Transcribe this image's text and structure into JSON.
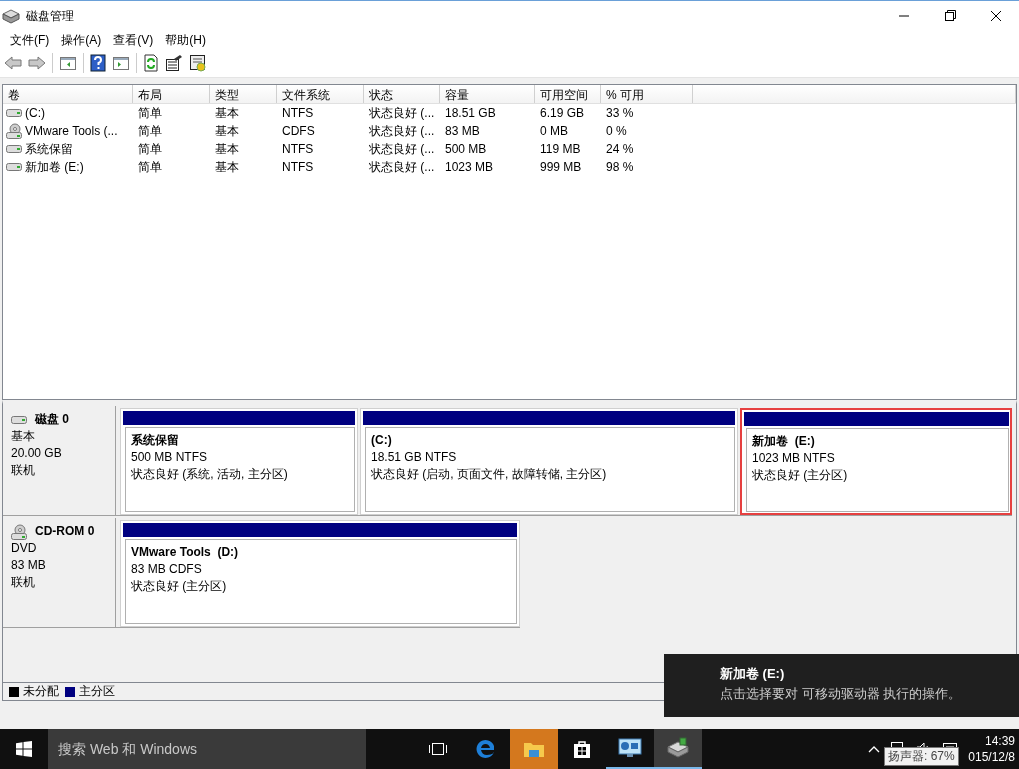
{
  "window": {
    "title": "磁盘管理"
  },
  "menu": [
    "文件(F)",
    "操作(A)",
    "查看(V)",
    "帮助(H)"
  ],
  "toolbar": [
    {
      "kind": "back",
      "disabled": true
    },
    {
      "kind": "forward",
      "disabled": true
    },
    {
      "kind": "sep"
    },
    {
      "kind": "pane",
      "disabled": false
    },
    {
      "kind": "sep"
    },
    {
      "kind": "help",
      "disabled": false
    },
    {
      "kind": "pane2",
      "disabled": false
    },
    {
      "kind": "sep"
    },
    {
      "kind": "refresh",
      "disabled": false
    },
    {
      "kind": "props",
      "disabled": false
    },
    {
      "kind": "settings",
      "disabled": false
    }
  ],
  "table": {
    "columns": [
      "卷",
      "布局",
      "类型",
      "文件系统",
      "状态",
      "容量",
      "可用空间",
      "% 可用"
    ],
    "rows": [
      {
        "kind": "disk",
        "cells": [
          "(C:)",
          "简单",
          "基本",
          "NTFS",
          "状态良好 (...",
          "18.51 GB",
          "6.19 GB",
          "33 %"
        ]
      },
      {
        "kind": "cdrom",
        "cells": [
          "VMware Tools (...",
          "简单",
          "基本",
          "CDFS",
          "状态良好 (...",
          "83 MB",
          "0 MB",
          "0 %"
        ]
      },
      {
        "kind": "disk",
        "cells": [
          "系统保留",
          "简单",
          "基本",
          "NTFS",
          "状态良好 (...",
          "500 MB",
          "119 MB",
          "24 %"
        ]
      },
      {
        "kind": "disk",
        "cells": [
          "新加卷 (E:)",
          "简单",
          "基本",
          "NTFS",
          "状态良好 (...",
          "1023 MB",
          "999 MB",
          "98 %"
        ]
      }
    ]
  },
  "disks": [
    {
      "kind": "disk",
      "name": "磁盘 0",
      "type": "基本",
      "size": "20.00 GB",
      "status": "联机",
      "partitions": [
        {
          "label": "系统保留",
          "size": "500 MB NTFS",
          "status": "状态良好 (系统, 活动, 主分区)",
          "selected": false
        },
        {
          "label": "(C:)",
          "size": "18.51 GB NTFS",
          "status": "状态良好 (启动, 页面文件, 故障转储, 主分区)",
          "selected": false
        },
        {
          "label": "新加卷  (E:)",
          "size": "1023 MB NTFS",
          "status": "状态良好 (主分区)",
          "selected": true
        }
      ]
    },
    {
      "kind": "cdrom",
      "name": "CD-ROM 0",
      "type": "DVD",
      "size": "83 MB",
      "status": "联机",
      "partitions": [
        {
          "label": "VMware Tools  (D:)",
          "size": "83 MB CDFS",
          "status": "状态良好 (主分区)",
          "selected": false
        }
      ]
    }
  ],
  "legend": [
    {
      "label": "未分配",
      "color": "#000000"
    },
    {
      "label": "主分区",
      "color": "#000080"
    }
  ],
  "toast": {
    "title": "新加卷 (E:)",
    "message": "点击选择要对 可移动驱动器 执行的操作。"
  },
  "taskbar": {
    "search_placeholder": "搜索 Web 和 Windows",
    "apps": [
      {
        "kind": "taskview",
        "running": false,
        "highlighted": false,
        "selected": false
      },
      {
        "kind": "edge",
        "running": false,
        "highlighted": false,
        "selected": false
      },
      {
        "kind": "explorer",
        "running": false,
        "highlighted": true,
        "selected": false
      },
      {
        "kind": "store",
        "running": false,
        "highlighted": false,
        "selected": false
      },
      {
        "kind": "monitor",
        "running": true,
        "highlighted": false,
        "selected": false
      },
      {
        "kind": "diskmgmt",
        "running": true,
        "highlighted": false,
        "selected": true
      }
    ],
    "time": "14:39",
    "date": "015/12/8",
    "tooltip": "扬声器: 67%"
  }
}
